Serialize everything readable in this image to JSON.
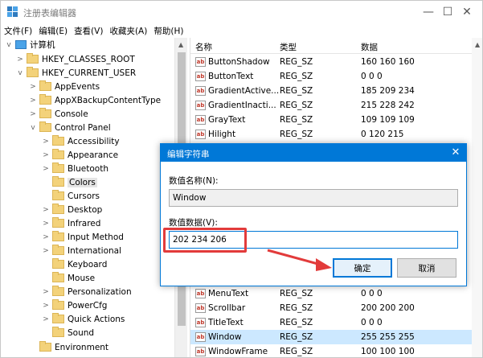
{
  "window": {
    "title": "注册表编辑器",
    "controls": {
      "minimize": "—",
      "maximize": "☐",
      "close": "✕"
    }
  },
  "menu": {
    "items": [
      "文件(F)",
      "编辑(E)",
      "查看(V)",
      "收藏夹(A)",
      "帮助(H)"
    ]
  },
  "tree": {
    "root": "计算机",
    "items": [
      {
        "label": "HKEY_CLASSES_ROOT",
        "expander": ">"
      },
      {
        "label": "HKEY_CURRENT_USER",
        "expander": "v"
      },
      {
        "label": "AppEvents",
        "expander": ">"
      },
      {
        "label": "AppXBackupContentType",
        "expander": ">"
      },
      {
        "label": "Console",
        "expander": ">"
      },
      {
        "label": "Control Panel",
        "expander": "v"
      },
      {
        "label": "Accessibility",
        "expander": ">"
      },
      {
        "label": "Appearance",
        "expander": ">"
      },
      {
        "label": "Bluetooth",
        "expander": ">"
      },
      {
        "label": "Colors",
        "expander": "",
        "selected": true
      },
      {
        "label": "Cursors",
        "expander": ""
      },
      {
        "label": "Desktop",
        "expander": ">"
      },
      {
        "label": "Infrared",
        "expander": ">"
      },
      {
        "label": "Input Method",
        "expander": ">"
      },
      {
        "label": "International",
        "expander": ">"
      },
      {
        "label": "Keyboard",
        "expander": ""
      },
      {
        "label": "Mouse",
        "expander": ""
      },
      {
        "label": "Personalization",
        "expander": ">"
      },
      {
        "label": "PowerCfg",
        "expander": ">"
      },
      {
        "label": "Quick Actions",
        "expander": ">"
      },
      {
        "label": "Sound",
        "expander": ""
      },
      {
        "label": "Environment",
        "expander": ""
      }
    ]
  },
  "list": {
    "headers": {
      "name": "名称",
      "type": "类型",
      "data": "数据"
    },
    "rows_top": [
      {
        "name": "ButtonShadow",
        "type": "REG_SZ",
        "data": "160 160 160"
      },
      {
        "name": "ButtonText",
        "type": "REG_SZ",
        "data": "0 0 0"
      },
      {
        "name": "GradientActive...",
        "type": "REG_SZ",
        "data": "185 209 234"
      },
      {
        "name": "GradientInacti...",
        "type": "REG_SZ",
        "data": "215 228 242"
      },
      {
        "name": "GrayText",
        "type": "REG_SZ",
        "data": "109 109 109"
      },
      {
        "name": "Hilight",
        "type": "REG_SZ",
        "data": "0 120 215"
      }
    ],
    "rows_bottom": [
      {
        "name": "MenuText",
        "type": "REG_SZ",
        "data": "0 0 0"
      },
      {
        "name": "Scrollbar",
        "type": "REG_SZ",
        "data": "200 200 200"
      },
      {
        "name": "TitleText",
        "type": "REG_SZ",
        "data": "0 0 0"
      },
      {
        "name": "Window",
        "type": "REG_SZ",
        "data": "255 255 255",
        "selected": true
      },
      {
        "name": "WindowFrame",
        "type": "REG_SZ",
        "data": "100 100 100"
      }
    ]
  },
  "dialog": {
    "title": "编辑字符串",
    "close": "✕",
    "name_label": "数值名称(N):",
    "name_value": "Window",
    "data_label": "数值数据(V):",
    "data_value": "202 234 206",
    "ok_label": "确定",
    "cancel_label": "取消"
  },
  "colors": {
    "accent": "#0078d7",
    "selection": "#cce8ff",
    "annotation": "#e23b3b"
  }
}
